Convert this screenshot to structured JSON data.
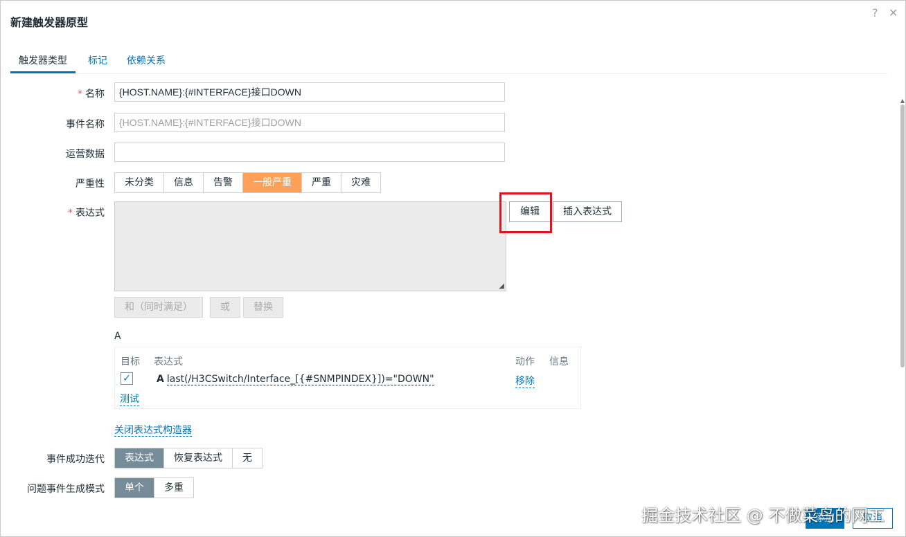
{
  "dialog": {
    "title": "新建触发器原型",
    "help_icon": "?",
    "close_icon": "✕"
  },
  "tabs": [
    {
      "label": "触发器类型",
      "active": true
    },
    {
      "label": "标记",
      "active": false
    },
    {
      "label": "依赖关系",
      "active": false
    }
  ],
  "form": {
    "name": {
      "label": "名称",
      "required": true,
      "value": "{HOST.NAME}:{#INTERFACE}接口DOWN"
    },
    "event_name": {
      "label": "事件名称",
      "placeholder": "{HOST.NAME}:{#INTERFACE}接口DOWN"
    },
    "opdata": {
      "label": "运营数据",
      "value": ""
    },
    "severity": {
      "label": "严重性",
      "options": [
        "未分类",
        "信息",
        "告警",
        "一般严重",
        "严重",
        "灾难"
      ],
      "selected": "一般严重",
      "selected_color": "#ffa059"
    },
    "expression": {
      "label": "表达式",
      "required": true,
      "edit_button": "编辑",
      "insert_button": "插入表达式",
      "and_button": "和（同时满足）",
      "or_button": "或",
      "replace_button": "替换"
    },
    "builder": {
      "group_label": "A",
      "headers": {
        "target": "目标",
        "expression": "表达式",
        "action": "动作",
        "info": "信息"
      },
      "row": {
        "checked": true,
        "id": "A",
        "expression": "last(/H3CSwitch/Interface_[{#SNMPINDEX}])=\"DOWN\"",
        "action": "移除"
      },
      "test_link": "测试",
      "close_link": "关闭表达式构造器"
    },
    "ok_event": {
      "label": "事件成功迭代",
      "options": [
        "表达式",
        "恢复表达式",
        "无"
      ],
      "selected": "表达式"
    },
    "problem_mode": {
      "label": "问题事件生成模式",
      "options": [
        "单个",
        "多重"
      ],
      "selected": "单个"
    }
  },
  "footer": {
    "add_button": "添加",
    "cancel_button": "取消"
  },
  "watermark": "掘金技术社区 @ 不做菜鸟的网工"
}
